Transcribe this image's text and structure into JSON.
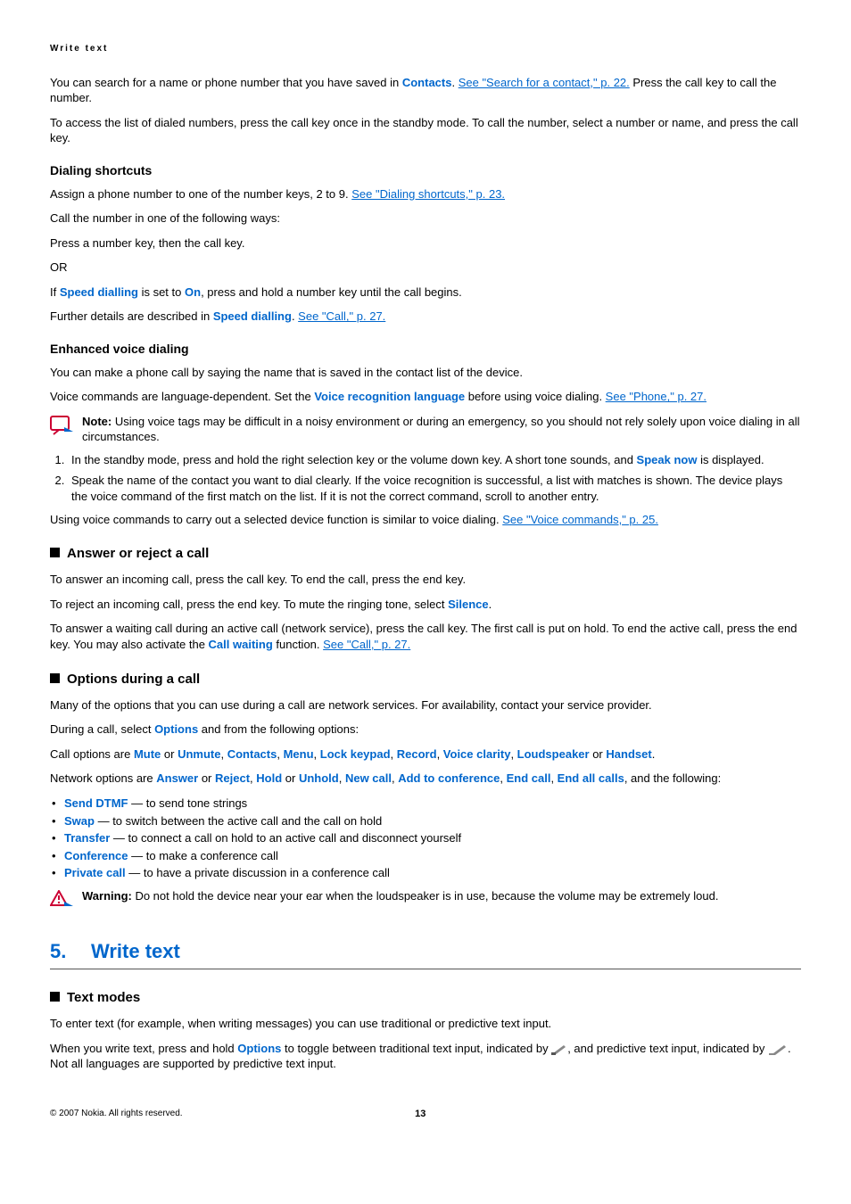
{
  "header": "Write text",
  "p1a": "You can search for a name or phone number that you have saved in ",
  "p1b": "Contacts",
  "p1c": ". ",
  "p1link": "See \"Search for a contact,\" p. 22.",
  "p1d": " Press the call key to call the number.",
  "p2": "To access the list of dialed numbers, press the call key once in the standby mode. To call the number, select a number or name, and press the call key.",
  "h_dialshort": "Dialing shortcuts",
  "p3a": "Assign a phone number to one of the number keys, 2 to 9. ",
  "p3link": "See \"Dialing shortcuts,\" p. 23.",
  "p4": "Call the number in one of the following ways:",
  "p5": "Press a number key, then the call key.",
  "p6": "OR",
  "p7a": "If ",
  "p7b": "Speed dialling",
  "p7c": " is set to ",
  "p7d": "On",
  "p7e": ", press and hold a number key until the call begins.",
  "p8a": "Further details are described in ",
  "p8b": "Speed dialling",
  "p8c": ". ",
  "p8link": "See \"Call,\" p. 27.",
  "h_evd": "Enhanced voice dialing",
  "p9": "You can make a phone call by saying the name that is saved in the contact list of the device.",
  "p10a": "Voice commands are language-dependent. Set the ",
  "p10b": "Voice recognition language",
  "p10c": " before using voice dialing. ",
  "p10link": "See \"Phone,\" p. 27.",
  "note_label": "Note:  ",
  "note_body": "Using voice tags may be difficult in a noisy environment or during an emergency, so you should not rely solely upon voice dialing in all circumstances.",
  "ol1a": "In the standby mode, press and hold the right selection key or the volume down key. A short tone sounds, and ",
  "ol1b": "Speak now",
  "ol1c": " is displayed.",
  "ol2": "Speak the name of the contact you want to dial clearly. If the voice recognition is successful, a list with matches is shown. The device plays the voice command of the first match on the list. If it is not the correct command, scroll to another entry.",
  "p11a": "Using voice commands to carry out a selected device function is similar to voice dialing. ",
  "p11link": "See \"Voice commands,\" p. 25.",
  "h_answer": "Answer or reject a call",
  "p12": "To answer an incoming call, press the call key. To end the call, press the end key.",
  "p13a": "To reject an incoming call, press the end key. To mute the ringing tone, select ",
  "p13b": "Silence",
  "p13c": ".",
  "p14a": "To answer a waiting call during an active call (network service), press the call key. The first call is put on hold. To end the active call, press the end key. You may also activate the ",
  "p14b": "Call waiting",
  "p14c": " function. ",
  "p14link": "See \"Call,\" p. 27.",
  "h_options": "Options during a call",
  "p15": "Many of the options that you can use during a call are network services. For availability, contact your service provider.",
  "p16a": "During a call, select ",
  "p16b": "Options",
  "p16c": " and from the following options:",
  "p17a": "Call options are ",
  "co": {
    "mute": "Mute",
    "unmute": "Unmute",
    "contacts": "Contacts",
    "menu": "Menu",
    "lock": "Lock keypad",
    "record": "Record",
    "clarity": "Voice clarity",
    "loud": "Loudspeaker",
    "handset": "Handset"
  },
  "p17or": " or ",
  "p17end": ".",
  "p18a": "Network options are ",
  "no": {
    "answer": "Answer",
    "reject": "Reject",
    "hold": "Hold",
    "unhold": "Unhold",
    "newcall": "New call",
    "addconf": "Add to conference",
    "endcall": "End call",
    "endall": "End all calls"
  },
  "p18end": ", and the following:",
  "li1a": "Send DTMF",
  "li1b": " —  to send tone strings",
  "li2a": "Swap",
  "li2b": " —  to switch between the active call and the call on hold",
  "li3a": "Transfer",
  "li3b": " —  to connect a call on hold to an active call and disconnect yourself",
  "li4a": "Conference",
  "li4b": " —  to make a conference call",
  "li5a": "Private call",
  "li5b": " — to have a private discussion in a conference call",
  "warn_label": "Warning:  ",
  "warn_body": "Do not hold the device near your ear when the loudspeaker is in use, because the volume may be extremely loud.",
  "ch_num": "5.",
  "ch_title": "Write text",
  "h_text": "Text modes",
  "p19": "To enter text (for example, when writing messages) you can use traditional or predictive text input.",
  "p20a": "When you write text, press and hold ",
  "p20b": "Options",
  "p20c": " to toggle between traditional text input, indicated by ",
  "p20d": ", and predictive text input, indicated by ",
  "p20e": ". Not all languages are supported by predictive text input.",
  "copyright": "© 2007 Nokia. All rights reserved.",
  "page": "13"
}
